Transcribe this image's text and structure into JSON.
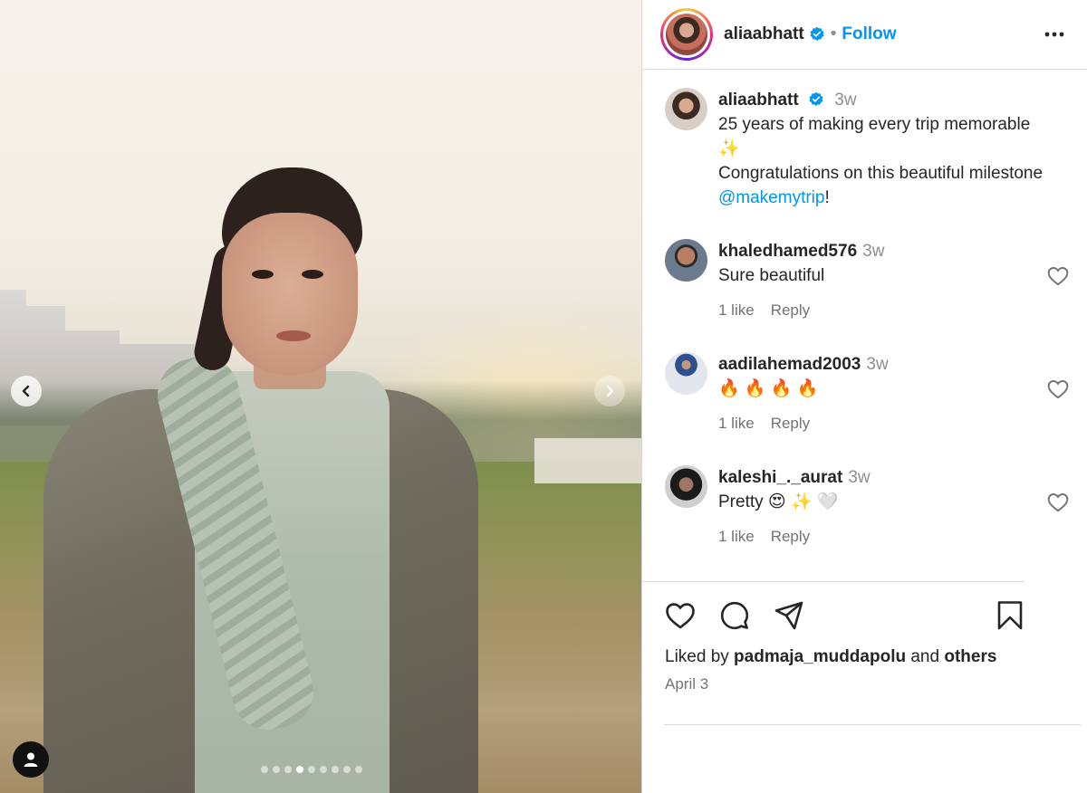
{
  "post": {
    "username": "aliaabhatt",
    "follow_label": "Follow",
    "separator": "•",
    "carousel": {
      "slide_count": 9,
      "active_index": 3
    }
  },
  "caption": {
    "username": "aliaabhatt",
    "time": "3w",
    "line1": "25 years of making every trip memorable",
    "emoji": "✨",
    "line2": "Congratulations on this beautiful milestone ",
    "mention": "@makemytrip",
    "end": "!"
  },
  "comments": [
    {
      "username": "khaledhamed576",
      "time": "3w",
      "text": "Sure beautiful",
      "likes": "1 like",
      "reply": "Reply"
    },
    {
      "username": "aadilahemad2003",
      "time": "3w",
      "text": "🔥 🔥 🔥 🔥",
      "likes": "1 like",
      "reply": "Reply"
    },
    {
      "username": "kaleshi_._aurat",
      "time": "3w",
      "text": "Pretty 😍 ✨ 🤍",
      "likes": "1 like",
      "reply": "Reply"
    }
  ],
  "likes": {
    "prefix": "Liked by ",
    "user": "padmaja_muddapolu",
    "middle": " and ",
    "others": "others"
  },
  "date": "April 3",
  "colors": {
    "accent": "#0095f6",
    "text": "#262626",
    "muted": "#737373",
    "border": "#dbdbdb"
  },
  "icons": [
    "verified-badge-icon",
    "more-options-icon",
    "chevron-left-icon",
    "chevron-right-icon",
    "user-tag-icon",
    "heart-icon",
    "comment-icon",
    "share-icon",
    "bookmark-icon"
  ]
}
